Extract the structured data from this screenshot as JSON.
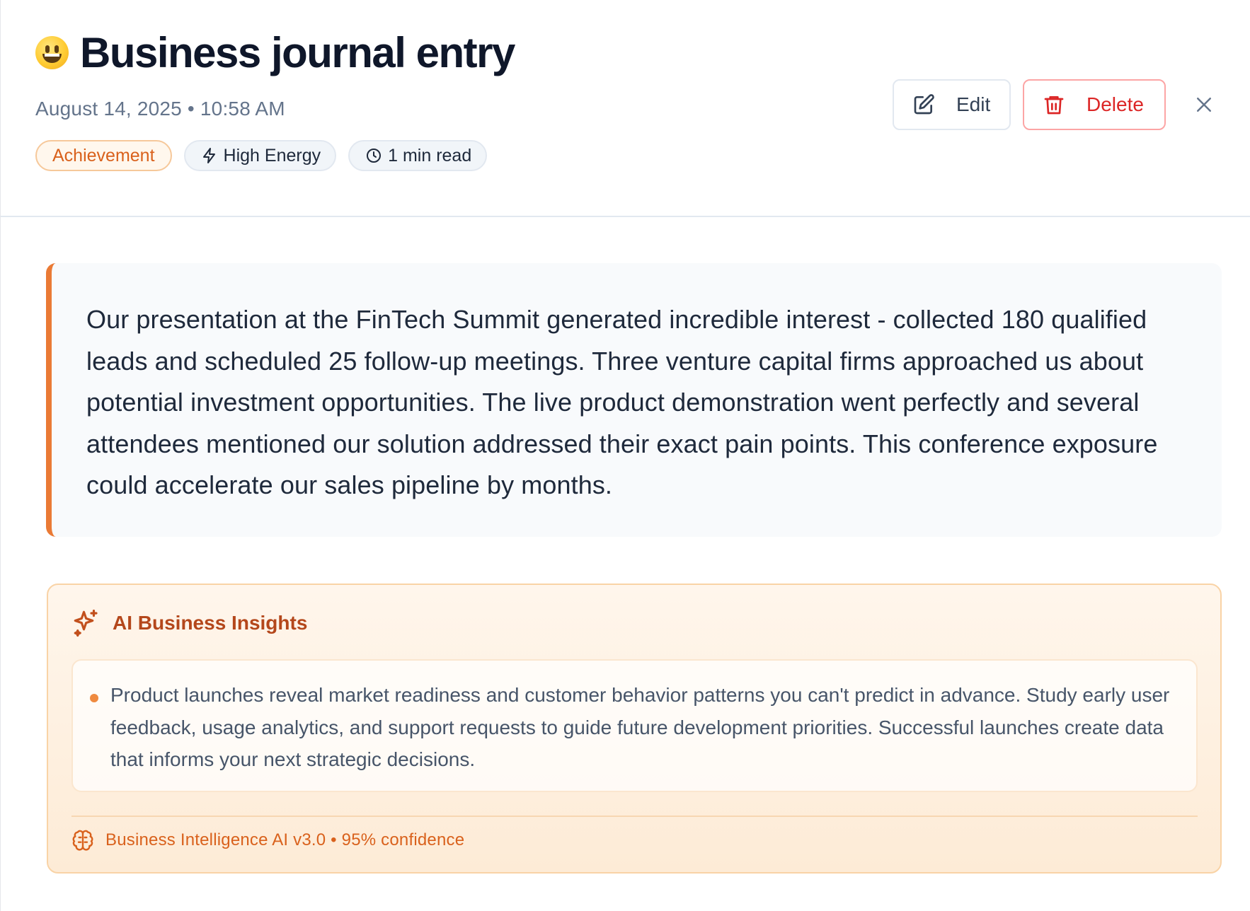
{
  "entry": {
    "mood_icon": "grinning-face-emoji",
    "title": "Business journal entry",
    "date": "August 14, 2025",
    "time": "10:58 AM",
    "meta_text": "August 14, 2025 • 10:58 AM",
    "tags": {
      "category": "Achievement",
      "energy": "High Energy",
      "read_time": "1 min read"
    },
    "body": "Our presentation at the FinTech Summit generated incredible interest - collected 180 qualified leads and scheduled 25 follow-up meetings. Three venture capital firms approached us about potential investment opportunities. The live product demonstration went perfectly and several attendees mentioned our solution addressed their exact pain points. This conference exposure could accelerate our sales pipeline by months."
  },
  "actions": {
    "edit_label": "Edit",
    "delete_label": "Delete"
  },
  "insights": {
    "title": "AI Business Insights",
    "items": [
      "Product launches reveal market readiness and customer behavior patterns you can't predict in advance. Study early user feedback, usage analytics, and support requests to guide future development priorities. Successful launches create data that informs your next strategic decisions."
    ],
    "footer": "Business Intelligence AI v3.0 • 95% confidence"
  },
  "colors": {
    "accent": "#ea7a35",
    "delete": "#dc2626",
    "insight_title": "#b4471b"
  }
}
